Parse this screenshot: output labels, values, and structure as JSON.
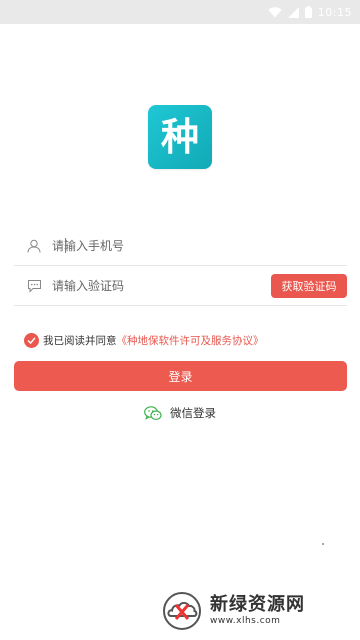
{
  "status_bar": {
    "time": "10:15"
  },
  "logo": {
    "text": "种"
  },
  "phone_field": {
    "placeholder": "请输入手机号",
    "value": ""
  },
  "code_field": {
    "placeholder": "请输入验证码",
    "value": ""
  },
  "get_code_button": {
    "label": "获取验证码"
  },
  "agreement": {
    "text": "我已阅读并同意",
    "link": "《种地保软件许可及服务协议》",
    "checked": true
  },
  "login_button": {
    "label": "登录"
  },
  "wechat_login": {
    "label": "微信登录"
  },
  "watermark": {
    "title": "新绿资源网",
    "url": "www.xlhs.com"
  },
  "colors": {
    "accent": "#e9574e",
    "logo_bg": "#1bbcc9",
    "wechat": "#3fb34f"
  }
}
